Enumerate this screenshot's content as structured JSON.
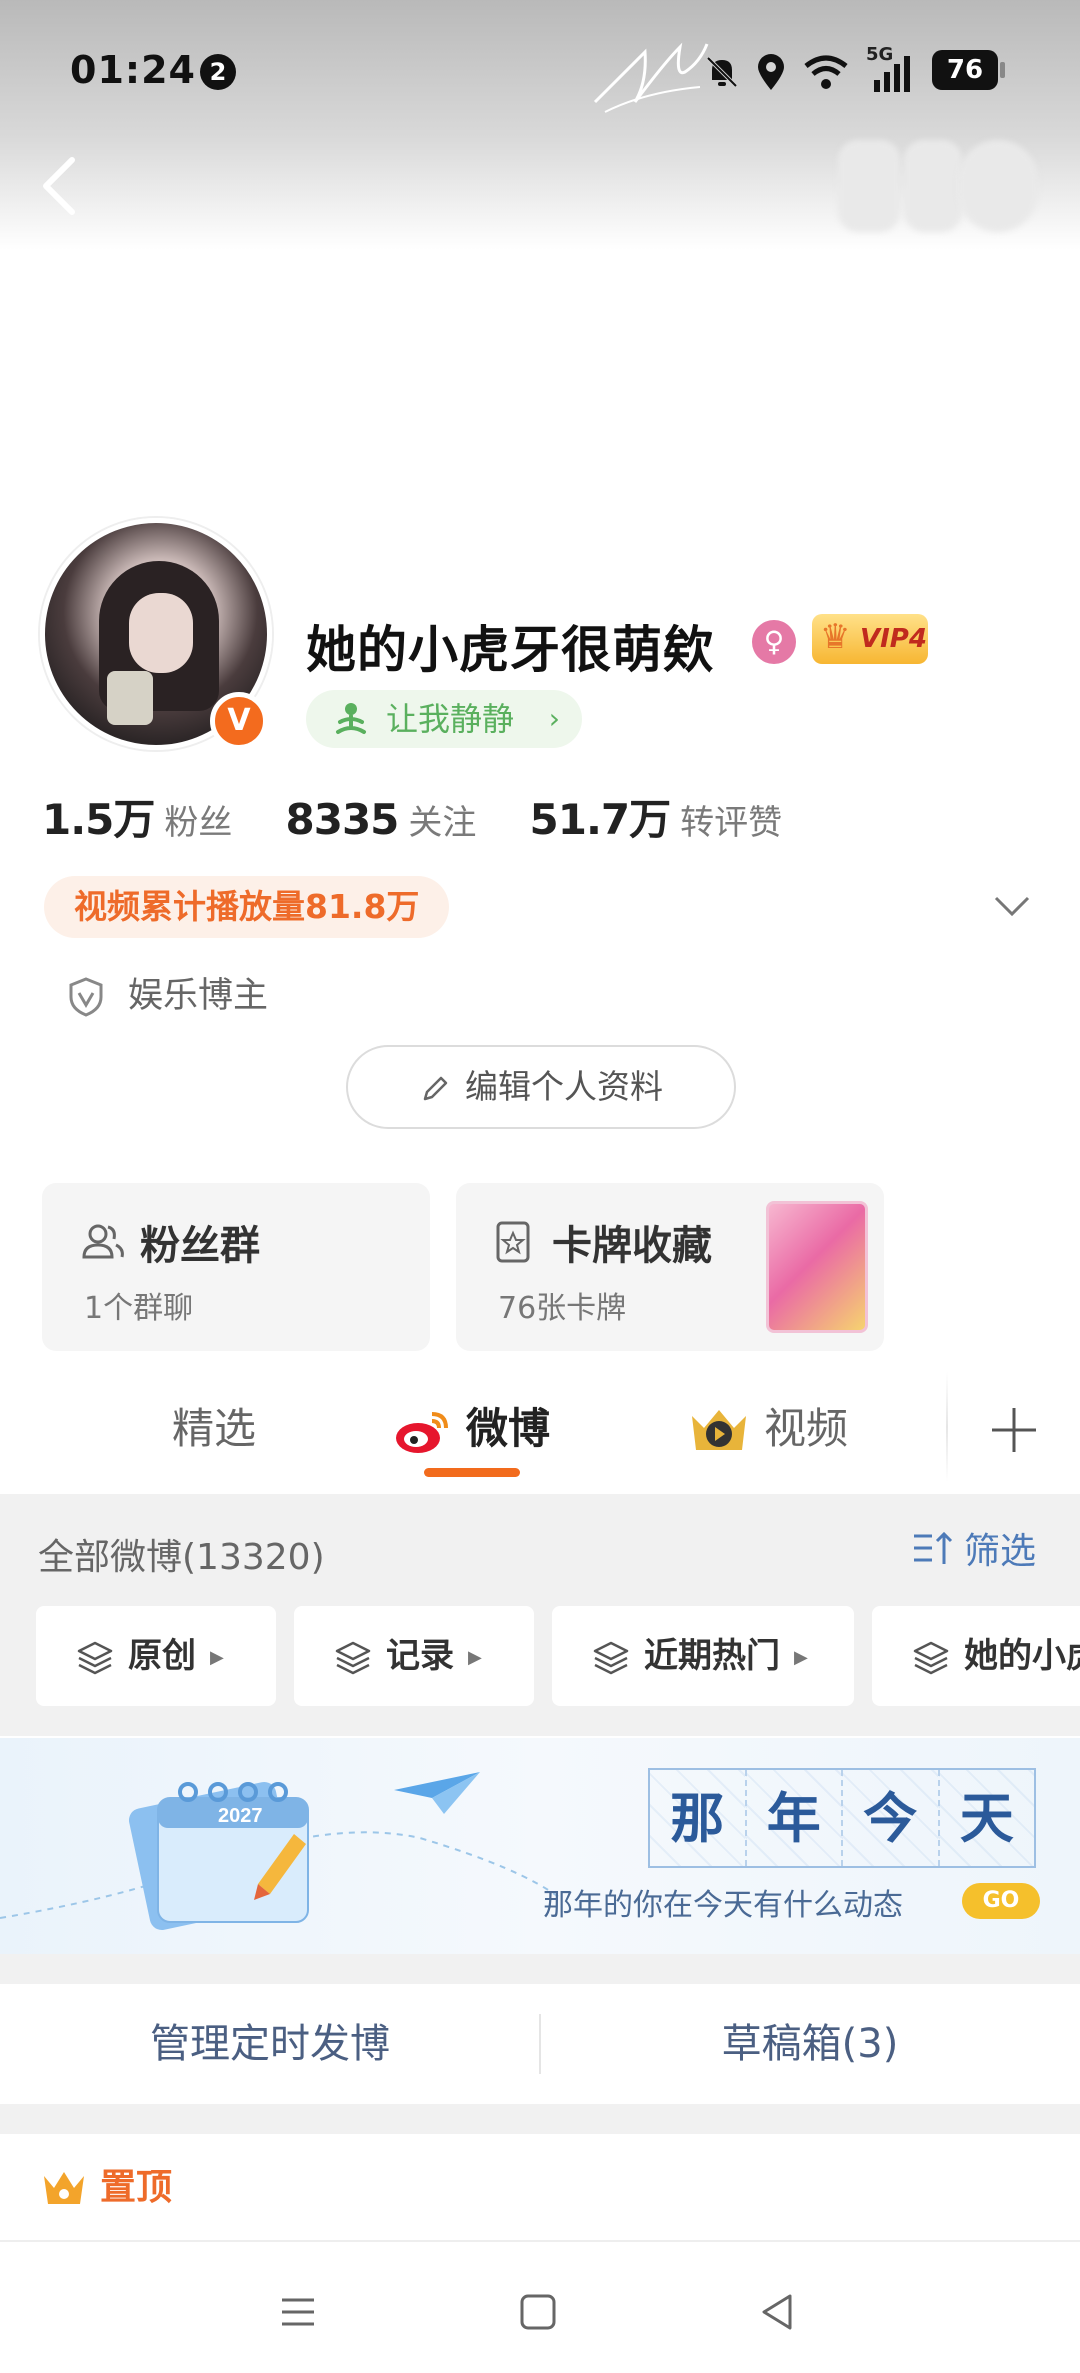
{
  "status_bar": {
    "time": "01:24",
    "notification_count": "2",
    "network": "5G",
    "battery": "76"
  },
  "profile": {
    "username": "她的小虎牙很萌欸",
    "vip_label": "VIP4",
    "status_text": "让我静静",
    "verified_badge": "V",
    "stats": [
      {
        "value": "1.5万",
        "label": "粉丝"
      },
      {
        "value": "8335",
        "label": "关注"
      },
      {
        "value": "51.7万",
        "label": "转评赞"
      }
    ],
    "video_plays": "视频累计播放量81.8万",
    "tag": "娱乐博主",
    "edit_button": "编辑个人资料"
  },
  "cards": {
    "fans_group": {
      "title": "粉丝群",
      "subtitle": "1个群聊"
    },
    "card_collection": {
      "title": "卡牌收藏",
      "subtitle": "76张卡牌"
    }
  },
  "tabs": [
    {
      "label": "精选",
      "active": false
    },
    {
      "label": "微博",
      "active": true
    },
    {
      "label": "视频",
      "active": false
    }
  ],
  "feed": {
    "count_label": "全部微博(13320)",
    "filter_label": "筛选",
    "chips": [
      "原创",
      "记录",
      "近期热门",
      "她的小虎"
    ]
  },
  "banner": {
    "calendar_year": "2027",
    "chars": [
      "那",
      "年",
      "今",
      "天"
    ],
    "subtitle": "那年的你在今天有什么动态",
    "go_label": "GO"
  },
  "actions": {
    "scheduled": "管理定时发博",
    "drafts": "草稿箱(3)"
  },
  "pinned_label": "置顶",
  "colors": {
    "accent": "#f26b1d",
    "link": "#4d7ab8",
    "status_green": "#5ab05e",
    "vip_gold": "#f7b632"
  }
}
